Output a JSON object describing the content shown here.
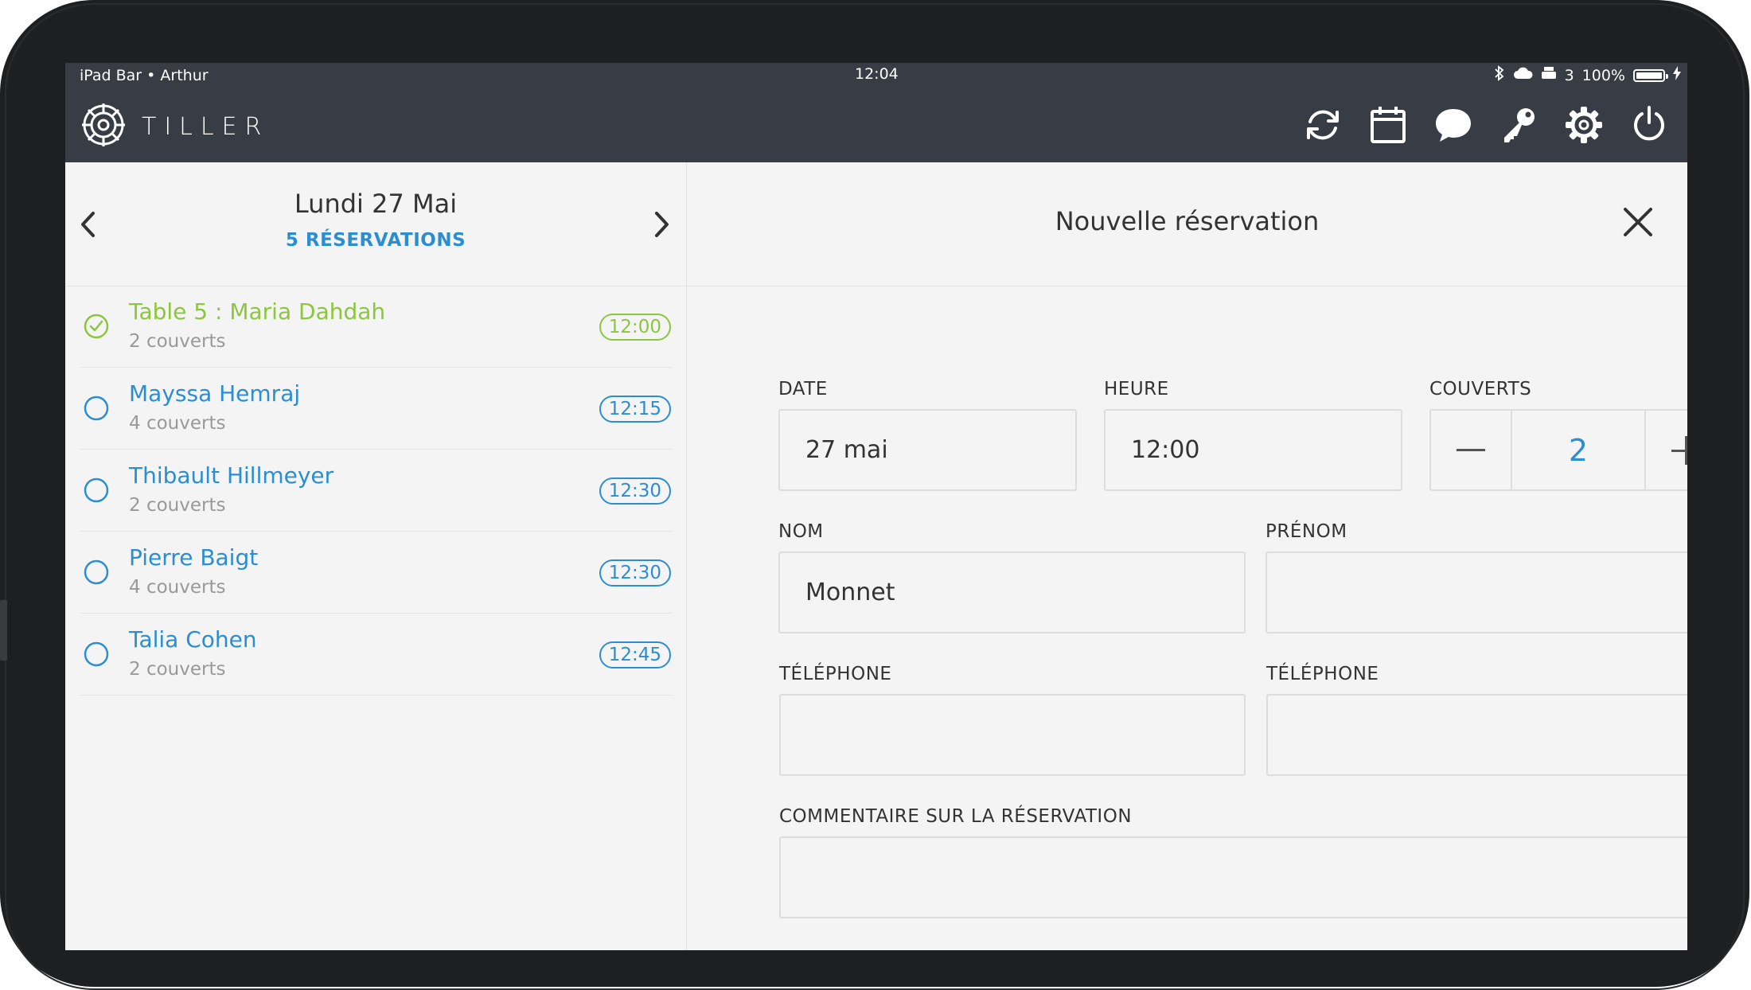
{
  "status_bar": {
    "device": "iPad Bar • Arthur",
    "time": "12:04",
    "notif_count": "3",
    "battery": "100%"
  },
  "app": {
    "brand": "TILLER",
    "nav_icons": [
      "refresh-icon",
      "calendar-icon",
      "chat-icon",
      "key-icon",
      "settings-icon",
      "power-icon"
    ]
  },
  "day": {
    "title": "Lundi 27 Mai",
    "count": "5 RÉSERVATIONS"
  },
  "reservations": [
    {
      "name": "Table 5 : Maria Dahdah",
      "covers": "2 couverts",
      "time": "12:00",
      "status": "done"
    },
    {
      "name": "Mayssa Hemraj",
      "covers": "4 couverts",
      "time": "12:15",
      "status": "pending"
    },
    {
      "name": "Thibault Hillmeyer",
      "covers": "2 couverts",
      "time": "12:30",
      "status": "pending"
    },
    {
      "name": "Pierre Baigt",
      "covers": "4 couverts",
      "time": "12:30",
      "status": "pending"
    },
    {
      "name": "Talia Cohen",
      "covers": "2 couverts",
      "time": "12:45",
      "status": "pending"
    }
  ],
  "form": {
    "title": "Nouvelle réservation",
    "date_label": "DATE",
    "date_value": "27 mai",
    "hour_label": "HEURE",
    "hour_value": "12:00",
    "covers_label": "COUVERTS",
    "covers_value": "2",
    "name_label": "NOM",
    "name_value": "Monnet",
    "firstname_label": "PRÉNOM",
    "firstname_value": "",
    "phone_label": "TÉLÉPHONE",
    "phone_value": "",
    "phone2_label": "TÉLÉPHONE",
    "phone2_value": "",
    "comment_label": "COMMENTAIRE SUR LA RÉSERVATION",
    "comment_value": ""
  },
  "colors": {
    "accent": "#2c8ed0",
    "done": "#8cc63f",
    "topbar": "#373c45"
  }
}
